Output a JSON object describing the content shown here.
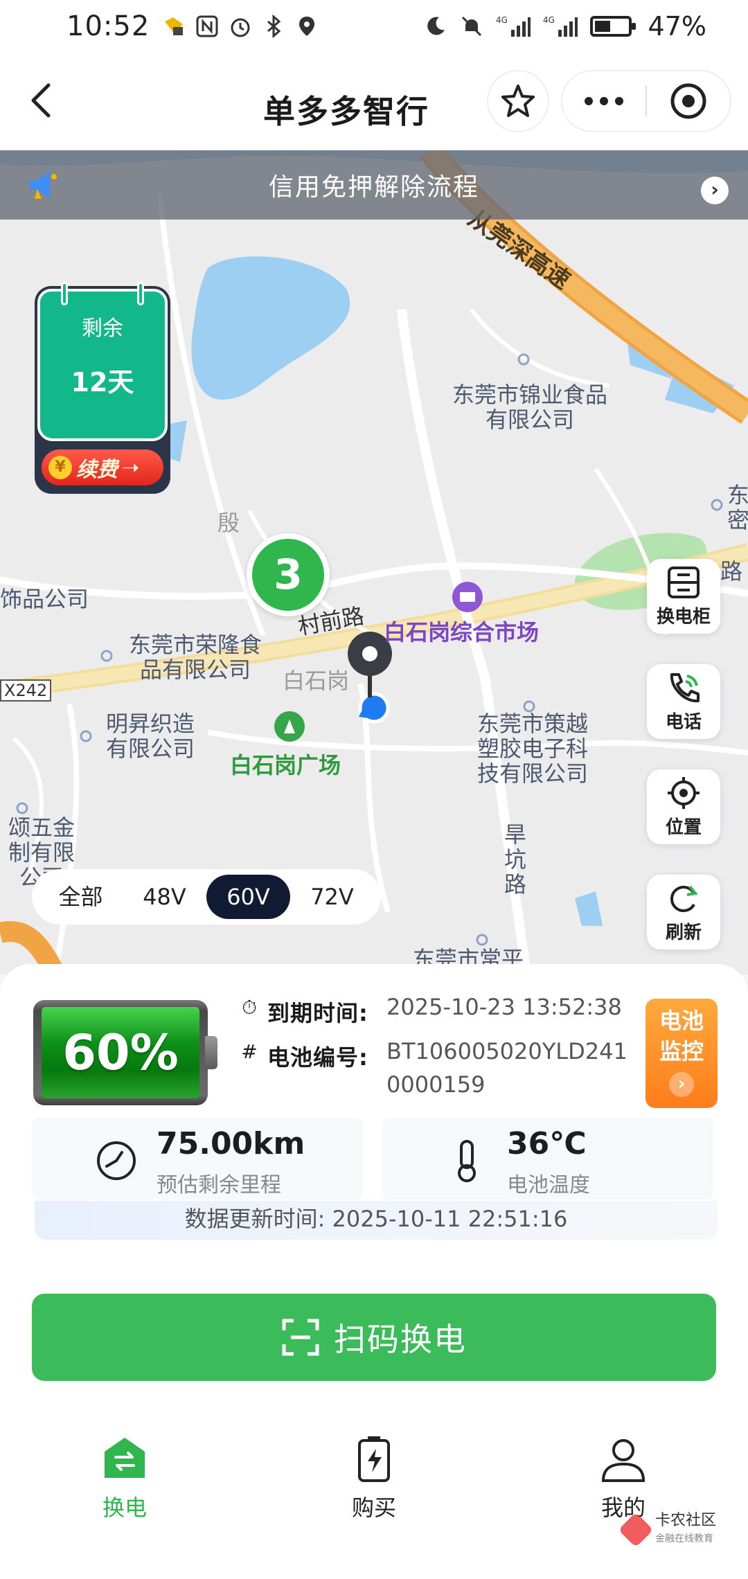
{
  "status_bar": {
    "time": "10:52",
    "battery_percent": "47%",
    "battery_level": 0.47
  },
  "header": {
    "title": "单多多智行",
    "icons": [
      "back-icon",
      "star-icon",
      "more-icon",
      "target-icon"
    ]
  },
  "notice": {
    "text": "信用免押解除流程"
  },
  "remaining": {
    "label": "剩余",
    "days": "12天",
    "renew_label": "续费",
    "renew_coin": "¥"
  },
  "map": {
    "cluster_count": "3",
    "labels": {
      "expressway": "从莞深高速",
      "jinye": "东莞市锦业食品有限公司",
      "ronglong": "东莞市荣隆食品有限公司",
      "mingsheng": "明昇织造有限公司",
      "cunqian_road": "村前路",
      "market": "白石岗综合市场",
      "baishigang_gray": "白石岗",
      "plaza": "白石岗广场",
      "ceyue": "东莞市策越塑胶电子科技有限公司",
      "hankeng": "旱坑路",
      "road_code": "X242",
      "shipin": "饰品公司",
      "jinzhi": "颂五金制有限公司",
      "yin": "殷",
      "changping": "东莞市常平",
      "dong_partial": "东密",
      "lu_partial": "路"
    }
  },
  "side_buttons": {
    "cabinet": "换电柜",
    "phone": "电话",
    "location": "位置",
    "refresh": "刷新"
  },
  "voltage_filter": {
    "options": [
      "全部",
      "48V",
      "60V",
      "72V"
    ],
    "selected": "60V"
  },
  "battery": {
    "percent": "60%",
    "level": 0.6,
    "expire_label": "到期时间:",
    "expire_value": "2025-10-23 13:52:38",
    "serial_label": "电池编号:",
    "serial_value": "BT106005020YLD2410000159",
    "monitor_label_1": "电池",
    "monitor_label_2": "监控",
    "range_value": "75.00km",
    "range_label": "预估剩余里程",
    "temp_value": "36℃",
    "temp_label": "电池温度",
    "updated_text": "数据更新时间: 2025-10-11 22:51:16"
  },
  "scan_button": {
    "label": "扫码换电"
  },
  "tabbar": {
    "items": [
      {
        "label": "换电",
        "icon": "swap-icon",
        "active": true
      },
      {
        "label": "购买",
        "icon": "battery-bolt-icon",
        "active": false
      },
      {
        "label": "我的",
        "icon": "user-icon",
        "active": false
      }
    ]
  },
  "watermark": {
    "text": "卡农社区",
    "sub": "金融在线教育"
  },
  "colors": {
    "primary_green": "#3bbb59",
    "navy": "#111a33",
    "orange": "#ff8a22",
    "teal": "#12b889"
  }
}
